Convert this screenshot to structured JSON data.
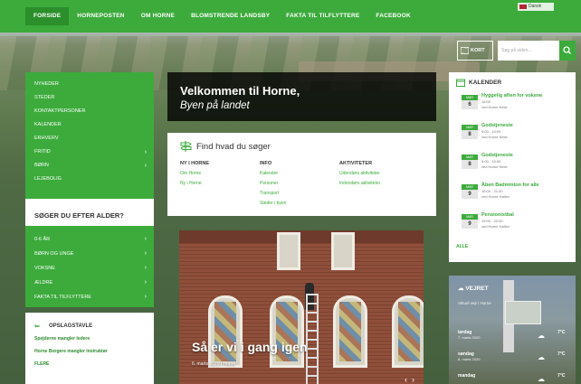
{
  "nav": {
    "items": [
      "FORSIDE",
      "HORNEPOSTEN",
      "OM HORNE",
      "BLOMSTRENDE LANDSBY",
      "FAKTA TIL TILFLYTTERE",
      "FACEBOOK"
    ],
    "language": "Dansk"
  },
  "search": {
    "map_label": "KORT",
    "placeholder": "Søg på siden..."
  },
  "left_menu": {
    "items": [
      {
        "label": "NYHEDER",
        "arrow": ""
      },
      {
        "label": "STEDER",
        "arrow": ""
      },
      {
        "label": "KONTAKTPERSONER",
        "arrow": ""
      },
      {
        "label": "KALENDER",
        "arrow": ""
      },
      {
        "label": "ERHVERV",
        "arrow": ""
      },
      {
        "label": "FRITID",
        "arrow": "›"
      },
      {
        "label": "BØRN",
        "arrow": "›"
      },
      {
        "label": "LEJEBOLIG",
        "arrow": ""
      }
    ]
  },
  "age": {
    "title": "SØGER DU EFTER ALDER?",
    "items": [
      {
        "label": "0-6 ÅR",
        "arrow": "›"
      },
      {
        "label": "BØRN OG UNGE",
        "arrow": "›"
      },
      {
        "label": "VOKSNE",
        "arrow": "›"
      },
      {
        "label": "ÆLDRE",
        "arrow": "›"
      },
      {
        "label": "FAKTA TIL TILFLYTTERE",
        "arrow": "›"
      }
    ]
  },
  "board": {
    "title": "OPSLAGSTAVLE",
    "links": [
      "Spejderne mangler ledere",
      "Horne Borgere mangler instruktør",
      "FLERE"
    ]
  },
  "welcome": {
    "title": "Velkommen til Horne,",
    "subtitle": "Byen på landet"
  },
  "find": {
    "title": "Find hvad du søger",
    "columns": [
      {
        "heading": "NY I HORNE",
        "links": [
          "Om Horne",
          "Ny i Horne"
        ]
      },
      {
        "heading": "INFO",
        "links": [
          "Kalender",
          "Personer",
          "Transport",
          "Steder i byen"
        ]
      },
      {
        "heading": "AKTIVITETER",
        "links": [
          "Udendørs aktiviteter",
          "Indendørs aktiviteter"
        ]
      }
    ]
  },
  "slide": {
    "caption": "Så er vi i gang igen",
    "meta": "6. marts 2020 i Horne"
  },
  "calendar": {
    "title": "KALENDER",
    "events": [
      {
        "month": "MAR",
        "day": "6",
        "title": "Hyggelig aften for voksne",
        "time": "18:00",
        "place": "ved Horne Kirke"
      },
      {
        "month": "MAR",
        "day": "8",
        "title": "Godstjeneste",
        "time": "9:00 - 10:00",
        "place": "ved Horne Kirke"
      },
      {
        "month": "MAR",
        "day": "8",
        "title": "Godstjeneste",
        "time": "9:00 - 10:00",
        "place": "ved Horne Kirke"
      },
      {
        "month": "MAR",
        "day": "9",
        "title": "Åben Badminton for alle",
        "time": "19:00 - 21:00",
        "place": "ved Horne Hallen"
      },
      {
        "month": "MAR",
        "day": "9",
        "title": "Pensionistbal",
        "time": "19:00 - 22:00",
        "place": "ved Horne Hallen"
      }
    ],
    "all_label": "ALLE"
  },
  "weather": {
    "title": "VEJRET",
    "subtitle": "Aktuel vejr i Horne",
    "days": [
      {
        "day": "lørdag",
        "date": "7. marts 2020",
        "icon": "☁",
        "temp": "7°C"
      },
      {
        "day": "søndag",
        "date": "8. marts 2020",
        "icon": "☁",
        "temp": "7°C"
      },
      {
        "day": "mandag",
        "date": "",
        "icon": "☁",
        "temp": "7°C"
      }
    ]
  },
  "colors": {
    "brand": "#3cab3c",
    "brand_dark": "#2b8f2b"
  }
}
